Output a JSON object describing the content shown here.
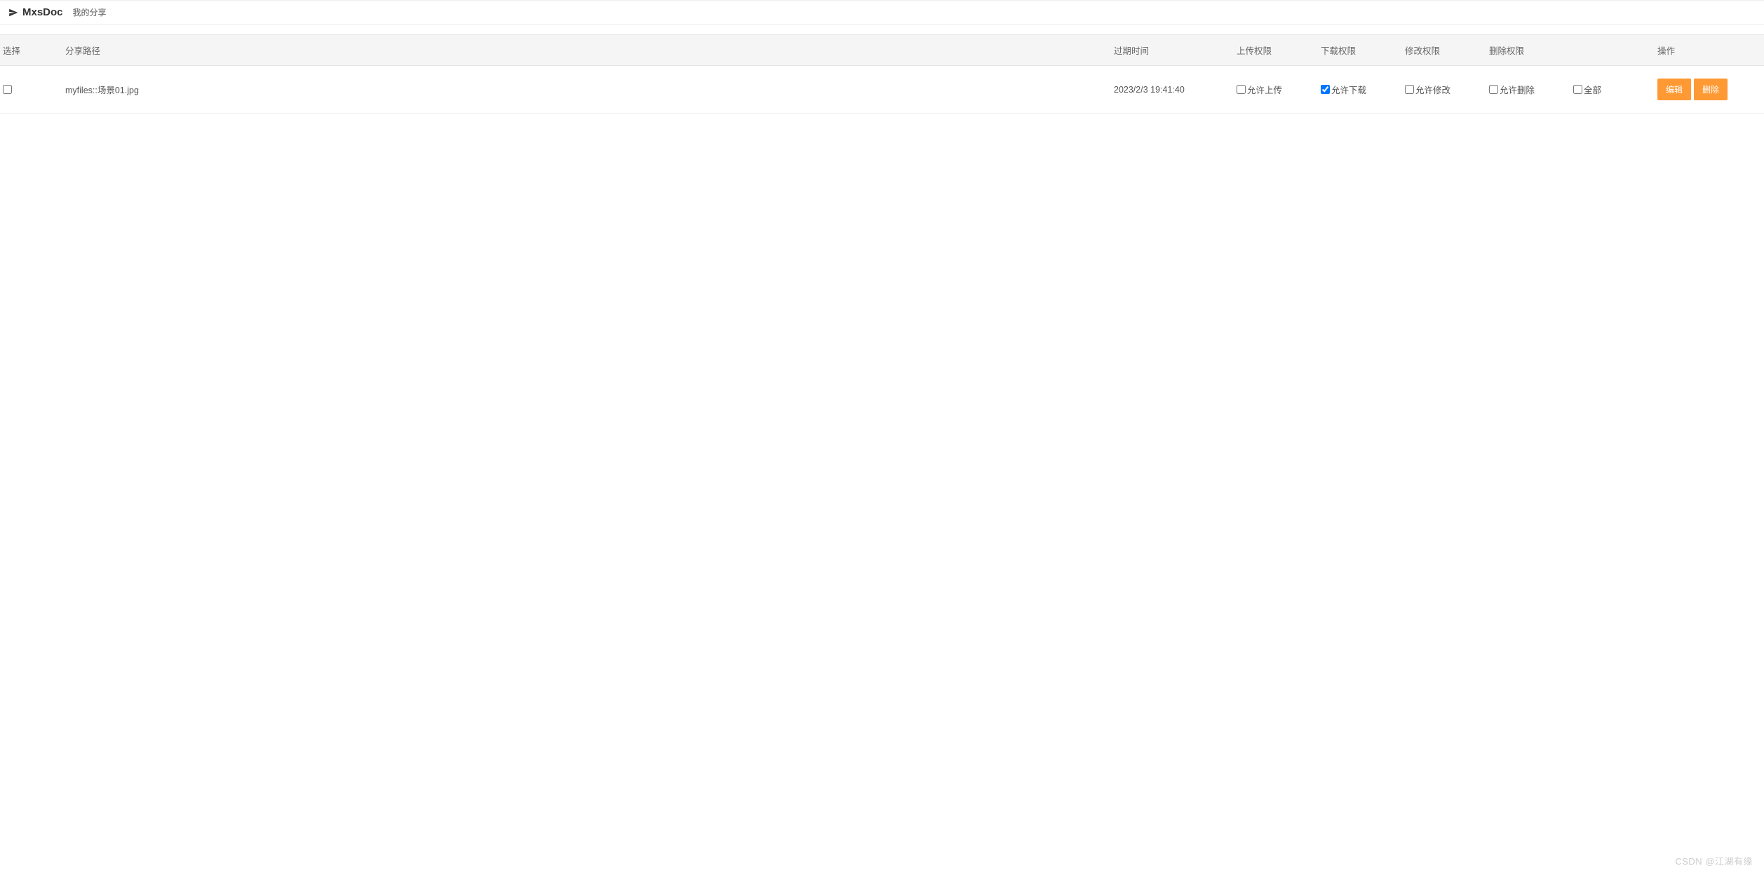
{
  "header": {
    "app_name": "MxsDoc",
    "page_title": "我的分享"
  },
  "table": {
    "columns": {
      "select": "选择",
      "path": "分享路径",
      "expire": "过期时间",
      "upload": "上传权限",
      "download": "下载权限",
      "modify": "修改权限",
      "delete": "删除权限",
      "action": "操作"
    },
    "rows": [
      {
        "path": "myfiles::场景01.jpg",
        "expire": "2023/2/3 19:41:40",
        "upload_label": "允许上传",
        "upload_checked": false,
        "download_label": "允许下载",
        "download_checked": true,
        "modify_label": "允许修改",
        "modify_checked": false,
        "delete_label": "允许删除",
        "delete_checked": false,
        "all_label": "全部",
        "all_checked": false,
        "edit_label": "编辑",
        "del_label": "删除"
      }
    ]
  },
  "watermark": "CSDN @江湖有缘"
}
